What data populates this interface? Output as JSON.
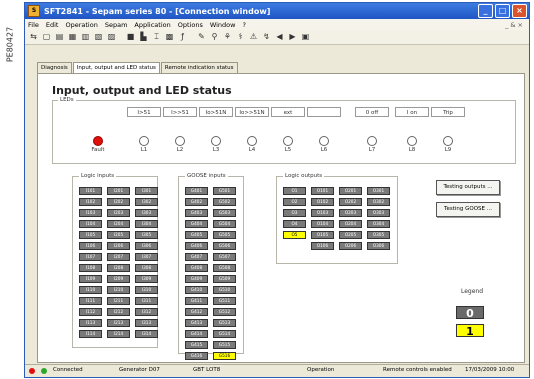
{
  "side_label": "PE80427",
  "window": {
    "title": "SFT2841 - Sepam series 80 - [Connection window]",
    "controls": [
      "_",
      "□",
      "×"
    ]
  },
  "menu": [
    "File",
    "Edit",
    "Operation",
    "Sepam",
    "Application",
    "Options",
    "Window",
    "?"
  ],
  "menu_right": "_ & ×",
  "tabs": [
    "Diagnosis",
    "Input, output and LED status",
    "Remote indication status"
  ],
  "heading": "Input, output and LED status",
  "leds": {
    "group_label": "LEDs",
    "items": [
      {
        "name": "",
        "label": "Fault",
        "state": "on"
      },
      {
        "name": "I>51",
        "label": "L1",
        "state": "off"
      },
      {
        "name": "I>>51",
        "label": "L2",
        "state": "off"
      },
      {
        "name": "Io>51N",
        "label": "L3",
        "state": "off"
      },
      {
        "name": "Io>>51N",
        "label": "L4",
        "state": "off"
      },
      {
        "name": "ext",
        "label": "L5",
        "state": "off"
      },
      {
        "name": "",
        "label": "L6",
        "state": "off"
      },
      {
        "name": "0 off",
        "label": "L7",
        "state": "off"
      },
      {
        "name": "I on",
        "label": "L8",
        "state": "off"
      },
      {
        "name": "Trip",
        "label": "L9",
        "state": "off"
      }
    ]
  },
  "logic_inputs": {
    "title": "Logic inputs",
    "rows": [
      [
        "I101",
        "I201",
        "I301"
      ],
      [
        "I102",
        "I202",
        "I302"
      ],
      [
        "I103",
        "I203",
        "I303"
      ],
      [
        "I104",
        "I204",
        "I304"
      ],
      [
        "I105",
        "I205",
        "I305"
      ],
      [
        "I106",
        "I206",
        "I306"
      ],
      [
        "I107",
        "I207",
        "I307"
      ],
      [
        "I108",
        "I208",
        "I308"
      ],
      [
        "I109",
        "I209",
        "I309"
      ],
      [
        "I110",
        "I210",
        "I310"
      ],
      [
        "I111",
        "I211",
        "I311"
      ],
      [
        "I112",
        "I212",
        "I312"
      ],
      [
        "I113",
        "I213",
        "I313"
      ],
      [
        "I114",
        "I214",
        "I314"
      ]
    ],
    "active": []
  },
  "goose_inputs": {
    "title": "GOOSE inputs",
    "rows": [
      [
        "G401",
        "G501"
      ],
      [
        "G402",
        "G502"
      ],
      [
        "G403",
        "G503"
      ],
      [
        "G404",
        "G504"
      ],
      [
        "G405",
        "G505"
      ],
      [
        "G406",
        "G506"
      ],
      [
        "G407",
        "G507"
      ],
      [
        "G408",
        "G508"
      ],
      [
        "G409",
        "G509"
      ],
      [
        "G410",
        "G510"
      ],
      [
        "G411",
        "G511"
      ],
      [
        "G412",
        "G512"
      ],
      [
        "G413",
        "G513"
      ],
      [
        "G414",
        "G514"
      ],
      [
        "G415",
        "G515"
      ],
      [
        "G416",
        "G516"
      ]
    ],
    "active": [
      "G516"
    ]
  },
  "logic_outputs": {
    "title": "Logic outputs",
    "rows": [
      [
        "O1",
        "O101",
        "O201",
        "O301"
      ],
      [
        "O2",
        "O102",
        "O202",
        "O302"
      ],
      [
        "O3",
        "O103",
        "O203",
        "O303"
      ],
      [
        "O4",
        "O104",
        "O204",
        "O304"
      ],
      [
        "O5",
        "O105",
        "O205",
        "O305"
      ],
      [
        "",
        "O106",
        "O206",
        "O306"
      ]
    ],
    "active": [
      "O5"
    ]
  },
  "buttons": {
    "testing_outputs": "Testing outputs ...",
    "testing_goose": "Testing GOOSE ..."
  },
  "legend": {
    "title": "Legend",
    "off_value": "0",
    "on_value": "1"
  },
  "status_bar": {
    "connected": "Connected",
    "generator": "Generator D07",
    "lot": "GBT LOT8",
    "mode": "Operation",
    "remote": "Remote controls enabled",
    "datetime": "17/03/2009  10:00"
  },
  "colors": {
    "active": "#ffff00",
    "inactive": "#7a7a7a",
    "fault_led": "#e0100a"
  }
}
